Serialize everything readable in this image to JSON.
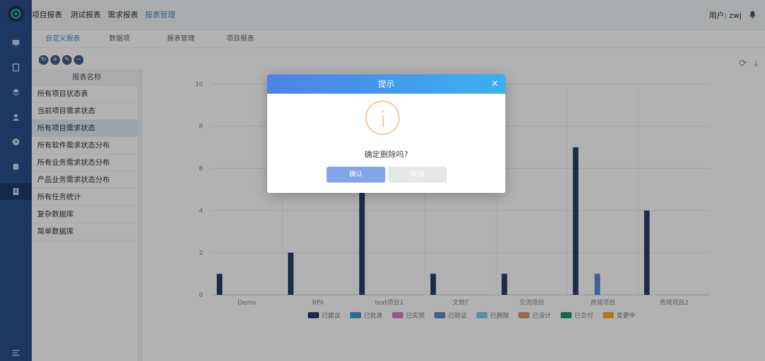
{
  "sidebar": {
    "icons": [
      "logo-icon",
      "monitor-icon",
      "document-icon",
      "layers-icon",
      "users-icon",
      "clock-icon",
      "database-icon",
      "report-icon",
      "menu-collapse-icon"
    ]
  },
  "topnav": {
    "items": [
      "项目报表",
      "测试报表",
      "需求报表",
      "报表管理"
    ],
    "active_index": 3,
    "user_label": "用户: zwj",
    "bell_icon": "bell-icon"
  },
  "tabs": {
    "items": [
      "自定义报表",
      "数据项",
      "报表管理",
      "项目报表"
    ],
    "active_index": 0
  },
  "toolbar": {
    "buttons": [
      "refresh-icon",
      "add-icon",
      "edit-icon",
      "delete-icon"
    ]
  },
  "report_list": {
    "header": "报表名称",
    "items": [
      "所有项目状态表",
      "当前项目需求状态",
      "所有项目需求状态",
      "所有软件需求状态分布",
      "所有业务需求状态分布",
      "产品业务需求状态分布",
      "所有任务统计",
      "复杂数据库",
      "简单数据库"
    ],
    "selected_index": 2
  },
  "chart_actions": [
    "refresh-icon",
    "download-icon"
  ],
  "chart_data": {
    "type": "bar",
    "categories": [
      "Demo",
      "RPA",
      "text项目1",
      "文档T",
      "交流项目",
      "商城项目",
      "商城项目2"
    ],
    "series": [
      {
        "name": "已建议",
        "color": "#2c3e66",
        "values": [
          1,
          2,
          5,
          1,
          1,
          7,
          4
        ]
      },
      {
        "name": "已批准",
        "color": "#3aa1c8",
        "values": [
          0,
          0,
          0,
          0,
          0,
          0,
          0
        ]
      },
      {
        "name": "已实现",
        "color": "#d77fc0",
        "values": [
          0,
          0,
          0,
          0,
          0,
          0,
          0
        ]
      },
      {
        "name": "已验证",
        "color": "#5b8ad3",
        "values": [
          0,
          0,
          0,
          0,
          0,
          1,
          0
        ]
      },
      {
        "name": "已删除",
        "color": "#7fcde0",
        "values": [
          0,
          0,
          0,
          0,
          0,
          0,
          0
        ]
      },
      {
        "name": "已设计",
        "color": "#d39a6a",
        "values": [
          0,
          0,
          0,
          0,
          0,
          0,
          0
        ]
      },
      {
        "name": "已交付",
        "color": "#1d9a69",
        "values": [
          0,
          0,
          0,
          0,
          0,
          0,
          0
        ]
      },
      {
        "name": "变更中",
        "color": "#f2b31a",
        "values": [
          0,
          0,
          0,
          0,
          0,
          0,
          0
        ]
      }
    ],
    "ylim": [
      0,
      10
    ],
    "yticks": [
      0,
      2,
      4,
      6,
      8,
      10
    ],
    "grid": true,
    "legend_position": "bottom"
  },
  "modal": {
    "title": "提示",
    "close_label": "×",
    "message": "确定删除吗?",
    "confirm_label": "确认",
    "cancel_label": "取消",
    "icon": "info-icon"
  }
}
